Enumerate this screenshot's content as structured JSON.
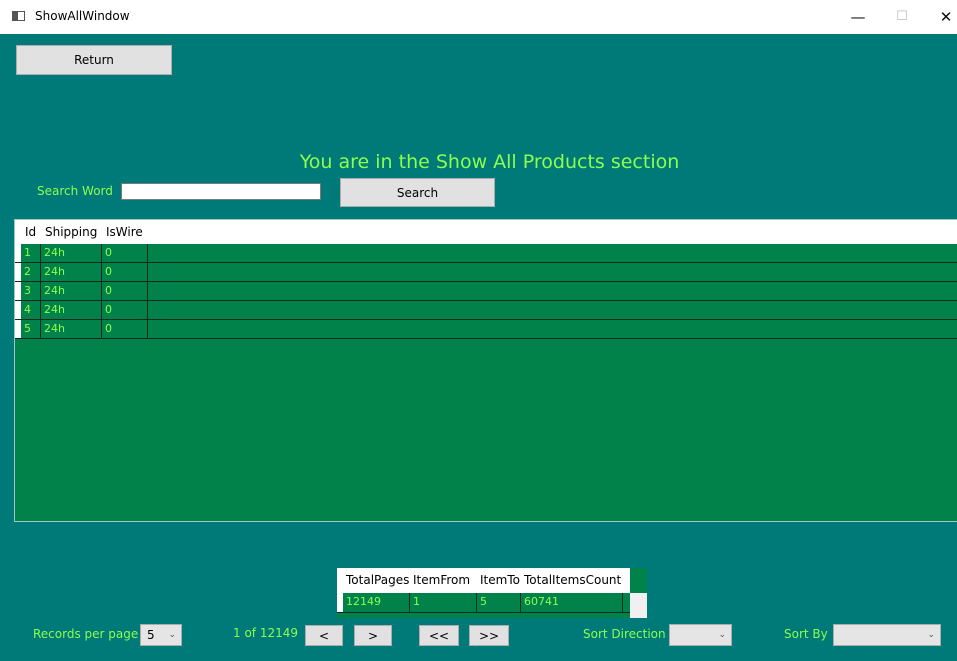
{
  "window": {
    "title": "ShowAllWindow",
    "minimize": "—",
    "maximize": "☐",
    "close": "✕"
  },
  "toolbar": {
    "return_label": "Return"
  },
  "heading": "You are in the Show All Products section",
  "search": {
    "label": "Search Word",
    "value": "",
    "button_label": "Search"
  },
  "products_grid": {
    "columns": [
      "Id",
      "Shipping",
      "IsWire"
    ],
    "rows": [
      [
        "1",
        "24h",
        "0"
      ],
      [
        "2",
        "24h",
        "0"
      ],
      [
        "3",
        "24h",
        "0"
      ],
      [
        "4",
        "24h",
        "0"
      ],
      [
        "5",
        "24h",
        "0"
      ]
    ]
  },
  "stats_grid": {
    "columns": [
      "TotalPages",
      "ItemFrom",
      "ItemTo",
      "TotalItemsCount"
    ],
    "rows": [
      [
        "12149",
        "1",
        "5",
        "60741"
      ]
    ]
  },
  "footer": {
    "records_label": "Records per page",
    "records_value": "5",
    "page_info": "1 of 12149",
    "prev_label": "<",
    "next_label": ">",
    "first_label": "<<",
    "last_label": ">>",
    "sort_direction_label": "Sort Direction",
    "sort_direction_value": "",
    "sort_by_label": "Sort By",
    "sort_by_value": ""
  },
  "colors": {
    "background": "#007a78",
    "grid": "#00824a",
    "label_text": "#8cff4a"
  }
}
